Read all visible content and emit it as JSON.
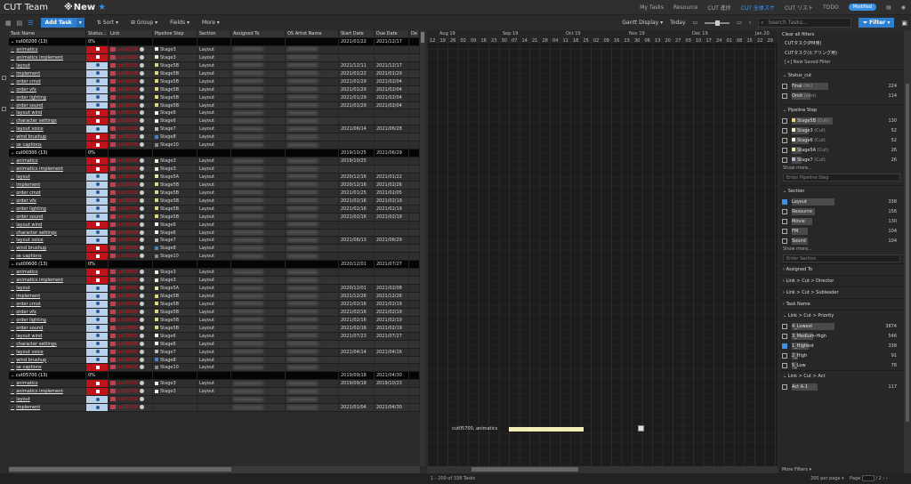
{
  "nav": {
    "brand": "CUT Team",
    "title": "New",
    "links": [
      "My Tasks",
      "Resource",
      "CUT 進捗",
      "CUT 全体スケ",
      "CUT リスト",
      "TODO"
    ],
    "active_link": "CUT 全体スケ",
    "badge": "Modified"
  },
  "toolbar": {
    "add_task": "Add Task",
    "sort": "Sort",
    "group": "Group",
    "fields": "Fields",
    "more": "More",
    "gantt_display": "Gantt Display",
    "today": "Today",
    "search_placeholder": "Search Tasks...",
    "filter": "Filter"
  },
  "grid": {
    "columns": [
      "Task Name",
      "Status...",
      "Link",
      "Pipeline Step",
      "Section",
      "Assigned To",
      "OS Artist Name",
      "Start Date",
      "Due Date",
      "De"
    ],
    "groups": [
      {
        "name": "cut00200",
        "count": "(13)",
        "pct": "0%",
        "start": "2021/01/22",
        "due": "2021/12/17",
        "tasks": [
          {
            "name": "animatics",
            "status": "red",
            "link": "cut00200",
            "step": "Stage3",
            "step_color": "#f0ead0",
            "section": "Layout",
            "start": "",
            "due": ""
          },
          {
            "name": "animatics implement",
            "status": "red",
            "link": "cut00200",
            "step": "Stage3",
            "step_color": "#f0ead0",
            "section": "Layout",
            "start": "",
            "due": ""
          },
          {
            "name": "layout",
            "status": "blue",
            "link": "cut00200",
            "step": "Stage5B",
            "step_color": "#e6d27a",
            "section": "Layout",
            "start": "2021/12/11",
            "due": "2021/12/17"
          },
          {
            "name": "implement",
            "status": "blue",
            "link": "cut00200",
            "step": "Stage5B",
            "step_color": "#e6d27a",
            "section": "Layout",
            "start": "2021/01/22",
            "due": "2021/01/29"
          },
          {
            "name": "order cmot",
            "status": "blue",
            "link": "cut00200",
            "step": "Stage5B",
            "step_color": "#e6d27a",
            "section": "Layout",
            "start": "2021/01/29",
            "due": "2021/02/04"
          },
          {
            "name": "order vfx",
            "status": "blue",
            "link": "cut00200",
            "step": "Stage5B",
            "step_color": "#e6d27a",
            "section": "Layout",
            "start": "2021/01/29",
            "due": "2021/02/04"
          },
          {
            "name": "order lighting",
            "status": "blue",
            "link": "cut00200",
            "step": "Stage5B",
            "step_color": "#e6d27a",
            "section": "Layout",
            "start": "2021/01/29",
            "due": "2021/02/04"
          },
          {
            "name": "order sound",
            "status": "blue",
            "link": "cut00200",
            "step": "Stage5B",
            "step_color": "#e6d27a",
            "section": "Layout",
            "start": "2021/01/29",
            "due": "2021/02/04"
          },
          {
            "name": "layout wind",
            "status": "red",
            "link": "cut00200",
            "step": "Stage6",
            "step_color": "#f5f0e0",
            "section": "Layout",
            "start": "",
            "due": ""
          },
          {
            "name": "character settings",
            "status": "red",
            "link": "cut00200",
            "step": "Stage6",
            "step_color": "#f5f0e0",
            "section": "Layout",
            "start": "",
            "due": ""
          },
          {
            "name": "layout voice",
            "status": "blue",
            "link": "cut00200",
            "step": "Stage7",
            "step_color": "#aeb6c8",
            "section": "Layout",
            "start": "2021/06/14",
            "due": "2021/06/28"
          },
          {
            "name": "wind brushup",
            "status": "red",
            "link": "cut00200",
            "step": "Stage8",
            "step_color": "#4a7fc8",
            "section": "Layout",
            "start": "",
            "due": ""
          },
          {
            "name": "se captions",
            "status": "red",
            "link": "cut00200",
            "step": "Stage10",
            "step_color": "#8a8a8a",
            "section": "Layout",
            "start": "",
            "due": ""
          }
        ]
      },
      {
        "name": "cut00300",
        "count": "(13)",
        "pct": "0%",
        "start": "2019/10/25",
        "due": "2021/06/29",
        "tasks": [
          {
            "name": "animatics",
            "status": "red",
            "link": "cut00300",
            "step": "Stage3",
            "step_color": "#f0ead0",
            "section": "Layout",
            "start": "2019/10/25",
            "due": ""
          },
          {
            "name": "animatics implement",
            "status": "red",
            "link": "cut00300",
            "step": "Stage3",
            "step_color": "#f0ead0",
            "section": "Layout",
            "start": "",
            "due": ""
          },
          {
            "name": "layout",
            "status": "blue",
            "link": "cut00300",
            "step": "Stage5A",
            "step_color": "#f0e2a0",
            "section": "Layout",
            "start": "2020/12/16",
            "due": "2021/01/22"
          },
          {
            "name": "implement",
            "status": "blue",
            "link": "cut00300",
            "step": "Stage5B",
            "step_color": "#e6d27a",
            "section": "Layout",
            "start": "2020/12/16",
            "due": "2021/02/26"
          },
          {
            "name": "order cmot",
            "status": "blue",
            "link": "cut00300",
            "step": "Stage5B",
            "step_color": "#e6d27a",
            "section": "Layout",
            "start": "2021/01/25",
            "due": "2021/02/05"
          },
          {
            "name": "order vfx",
            "status": "blue",
            "link": "cut00300",
            "step": "Stage5B",
            "step_color": "#e6d27a",
            "section": "Layout",
            "start": "2021/02/16",
            "due": "2021/02/19"
          },
          {
            "name": "order lighting",
            "status": "blue",
            "link": "cut00300",
            "step": "Stage5B",
            "step_color": "#e6d27a",
            "section": "Layout",
            "start": "2021/02/16",
            "due": "2021/02/19"
          },
          {
            "name": "order sound",
            "status": "blue",
            "link": "cut00300",
            "step": "Stage5B",
            "step_color": "#e6d27a",
            "section": "Layout",
            "start": "2021/02/16",
            "due": "2021/02/19"
          },
          {
            "name": "layout wind",
            "status": "red",
            "link": "cut00300",
            "step": "Stage6",
            "step_color": "#f5f0e0",
            "section": "Layout",
            "start": "",
            "due": ""
          },
          {
            "name": "character settings",
            "status": "blue",
            "link": "cut00300",
            "step": "Stage6",
            "step_color": "#f5f0e0",
            "section": "Layout",
            "start": "",
            "due": ""
          },
          {
            "name": "layout voice",
            "status": "blue",
            "link": "cut00300",
            "step": "Stage7",
            "step_color": "#aeb6c8",
            "section": "Layout",
            "start": "2021/06/13",
            "due": "2021/06/29"
          },
          {
            "name": "wind brushup",
            "status": "red",
            "link": "cut00300",
            "step": "Stage8",
            "step_color": "#4a7fc8",
            "section": "Layout",
            "start": "",
            "due": ""
          },
          {
            "name": "se captions",
            "status": "red",
            "link": "cut00300",
            "step": "Stage10",
            "step_color": "#8a8a8a",
            "section": "Layout",
            "start": "",
            "due": ""
          }
        ]
      },
      {
        "name": "cut00600",
        "count": "(13)",
        "pct": "0%",
        "start": "2020/12/01",
        "due": "2021/07/27",
        "tasks": [
          {
            "name": "animatics",
            "status": "red",
            "link": "cut00600",
            "step": "Stage3",
            "step_color": "#f0ead0",
            "section": "Layout",
            "start": "",
            "due": ""
          },
          {
            "name": "animatics implement",
            "status": "red",
            "link": "cut00600",
            "step": "Stage3",
            "step_color": "#f0ead0",
            "section": "Layout",
            "start": "",
            "due": ""
          },
          {
            "name": "layout",
            "status": "blue",
            "link": "cut00600",
            "step": "Stage5A",
            "step_color": "#f0e2a0",
            "section": "Layout",
            "start": "2020/12/01",
            "due": "2021/02/08"
          },
          {
            "name": "implement",
            "status": "blue",
            "link": "cut00600",
            "step": "Stage5B",
            "step_color": "#e6d27a",
            "section": "Layout",
            "start": "2021/12/26",
            "due": "2021/12/26"
          },
          {
            "name": "order cmot",
            "status": "blue",
            "link": "cut00600",
            "step": "Stage5B",
            "step_color": "#e6d27a",
            "section": "Layout",
            "start": "2021/02/16",
            "due": "2021/02/19"
          },
          {
            "name": "order vfx",
            "status": "blue",
            "link": "cut00600",
            "step": "Stage5B",
            "step_color": "#e6d27a",
            "section": "Layout",
            "start": "2021/02/16",
            "due": "2021/02/19"
          },
          {
            "name": "order lighting",
            "status": "blue",
            "link": "cut00600",
            "step": "Stage5B",
            "step_color": "#e6d27a",
            "section": "Layout",
            "start": "2021/02/16",
            "due": "2021/02/19"
          },
          {
            "name": "order sound",
            "status": "blue",
            "link": "cut00600",
            "step": "Stage5B",
            "step_color": "#e6d27a",
            "section": "Layout",
            "start": "2021/02/16",
            "due": "2021/02/19"
          },
          {
            "name": "layout wind",
            "status": "blue",
            "link": "cut00600",
            "step": "Stage6",
            "step_color": "#f5f0e0",
            "section": "Layout",
            "start": "2021/07/23",
            "due": "2021/07/27"
          },
          {
            "name": "character settings",
            "status": "blue",
            "link": "cut00600",
            "step": "Stage6",
            "step_color": "#f5f0e0",
            "section": "Layout",
            "start": "",
            "due": ""
          },
          {
            "name": "layout voice",
            "status": "blue",
            "link": "cut00600",
            "step": "Stage7",
            "step_color": "#aeb6c8",
            "section": "Layout",
            "start": "2021/04/14",
            "due": "2021/04/16"
          },
          {
            "name": "wind brushup",
            "status": "blue",
            "link": "cut00600",
            "step": "Stage8",
            "step_color": "#4a7fc8",
            "section": "Layout",
            "start": "",
            "due": ""
          },
          {
            "name": "se captions",
            "status": "red",
            "link": "cut00600",
            "step": "Stage10",
            "step_color": "#8a8a8a",
            "section": "Layout",
            "start": "",
            "due": ""
          }
        ]
      },
      {
        "name": "cut05700",
        "count": "(13)",
        "pct": "0%",
        "start": "2019/09/18",
        "due": "2021/04/30",
        "tasks": [
          {
            "name": "animatics",
            "status": "red",
            "link": "cut05700",
            "step": "Stage3",
            "step_color": "#f0ead0",
            "section": "Layout",
            "start": "2019/09/18",
            "due": "2019/10/23"
          },
          {
            "name": "animatics implement",
            "status": "red",
            "link": "cut05700",
            "step": "Stage3",
            "step_color": "#f0ead0",
            "section": "Layout",
            "start": "",
            "due": ""
          },
          {
            "name": "layout",
            "status": "blue",
            "link": "cut05700",
            "step": "",
            "step_color": "",
            "section": "",
            "start": "",
            "due": ""
          },
          {
            "name": "implement",
            "status": "blue",
            "link": "cut05700",
            "step": "",
            "step_color": "",
            "section": "",
            "start": "2021/01/04",
            "due": "2021/04/30"
          }
        ]
      }
    ]
  },
  "gantt": {
    "months": [
      "Aug 19",
      "Sep 19",
      "Oct 19",
      "Nov 19",
      "Dec 19",
      "Jan 20"
    ],
    "days": [
      "12",
      "19",
      "26",
      "02",
      "09",
      "16",
      "23",
      "30",
      "07",
      "14",
      "21",
      "28",
      "04",
      "11",
      "18",
      "25",
      "02",
      "09",
      "16",
      "23",
      "30",
      "06",
      "13",
      "20",
      "27",
      "03",
      "10",
      "17",
      "24",
      "01",
      "08",
      "15",
      "22",
      "29"
    ],
    "bar_label": "cut05700, animatics",
    "footer": "1 - 200 of 338 Tasks"
  },
  "filters": {
    "clear": "Clear all filters",
    "saved": [
      "CUTタスク(PM用)",
      "CUTタスク(ヒアリング用)"
    ],
    "new_saved": "[+] New Saved Filter",
    "sections": [
      {
        "title": "Status_cut",
        "items": [
          {
            "label": "Final",
            "sub": "(fin)",
            "count": "224",
            "checked": false,
            "bar": 0.85
          },
          {
            "label": "Omit",
            "sub": "(omt)",
            "count": "114",
            "checked": false,
            "bar": 0.43
          }
        ]
      },
      {
        "title": "Pipeline Step",
        "items": [
          {
            "label": "Stage5B",
            "sub": "(Cut)",
            "count": "130",
            "checked": false,
            "bar": 0.95,
            "color": "#e6d27a"
          },
          {
            "label": "Stage3",
            "sub": "(Cut)",
            "count": "52",
            "checked": false,
            "bar": 0.4,
            "color": "#f0ead0"
          },
          {
            "label": "Stage6",
            "sub": "(Cut)",
            "count": "52",
            "checked": false,
            "bar": 0.4,
            "color": "#f5f0e0"
          },
          {
            "label": "Stage5A",
            "sub": "(Cut)",
            "count": "26",
            "checked": false,
            "bar": 0.22,
            "color": "#f0e2a0"
          },
          {
            "label": "Stage7",
            "sub": "(Cut)",
            "count": "26",
            "checked": false,
            "bar": 0.22,
            "color": "#aeb6c8"
          }
        ],
        "more": "Show more...",
        "input": "Enter Pipeline Step"
      },
      {
        "title": "Section",
        "items": [
          {
            "label": "Layout",
            "sub": "",
            "count": "338",
            "checked": true,
            "bar": 1.0
          },
          {
            "label": "Resource",
            "sub": "",
            "count": "156",
            "checked": false,
            "bar": 0.55
          },
          {
            "label": "Movie",
            "sub": "",
            "count": "130",
            "checked": false,
            "bar": 0.47
          },
          {
            "label": "FM",
            "sub": "",
            "count": "104",
            "checked": false,
            "bar": 0.38
          },
          {
            "label": "Sound",
            "sub": "",
            "count": "104",
            "checked": false,
            "bar": 0.38
          }
        ],
        "more": "Show more...",
        "input": "Enter Section"
      }
    ],
    "collapsed": [
      "Assigned To",
      "Link > Cut > Director",
      "Link > Cut > Subleader",
      "Task Name",
      "Link > Cut > Priority"
    ],
    "priority_items": [
      {
        "label": "4_Lowest",
        "sub": "",
        "count": "3874",
        "checked": false,
        "bar": 1.0
      },
      {
        "label": "3_Medium-High",
        "sub": "",
        "count": "546",
        "checked": false,
        "bar": 0.5
      },
      {
        "label": "1_Highest",
        "sub": "",
        "count": "338",
        "checked": true,
        "bar": 0.4
      },
      {
        "label": "2_High",
        "sub": "",
        "count": "91",
        "checked": false,
        "bar": 0.15
      },
      {
        "label": "5_Low",
        "sub": "",
        "count": "78",
        "checked": false,
        "bar": 0.12
      }
    ],
    "act_title": "Link > Cut > Act",
    "act_items": [
      {
        "label": "Act A-1",
        "sub": "",
        "count": "117",
        "checked": false,
        "bar": 0.6
      }
    ],
    "more_filters": "More Filters"
  },
  "status": {
    "per_page": "200 per page",
    "page_label": "Page",
    "page_of": "/ 2"
  }
}
